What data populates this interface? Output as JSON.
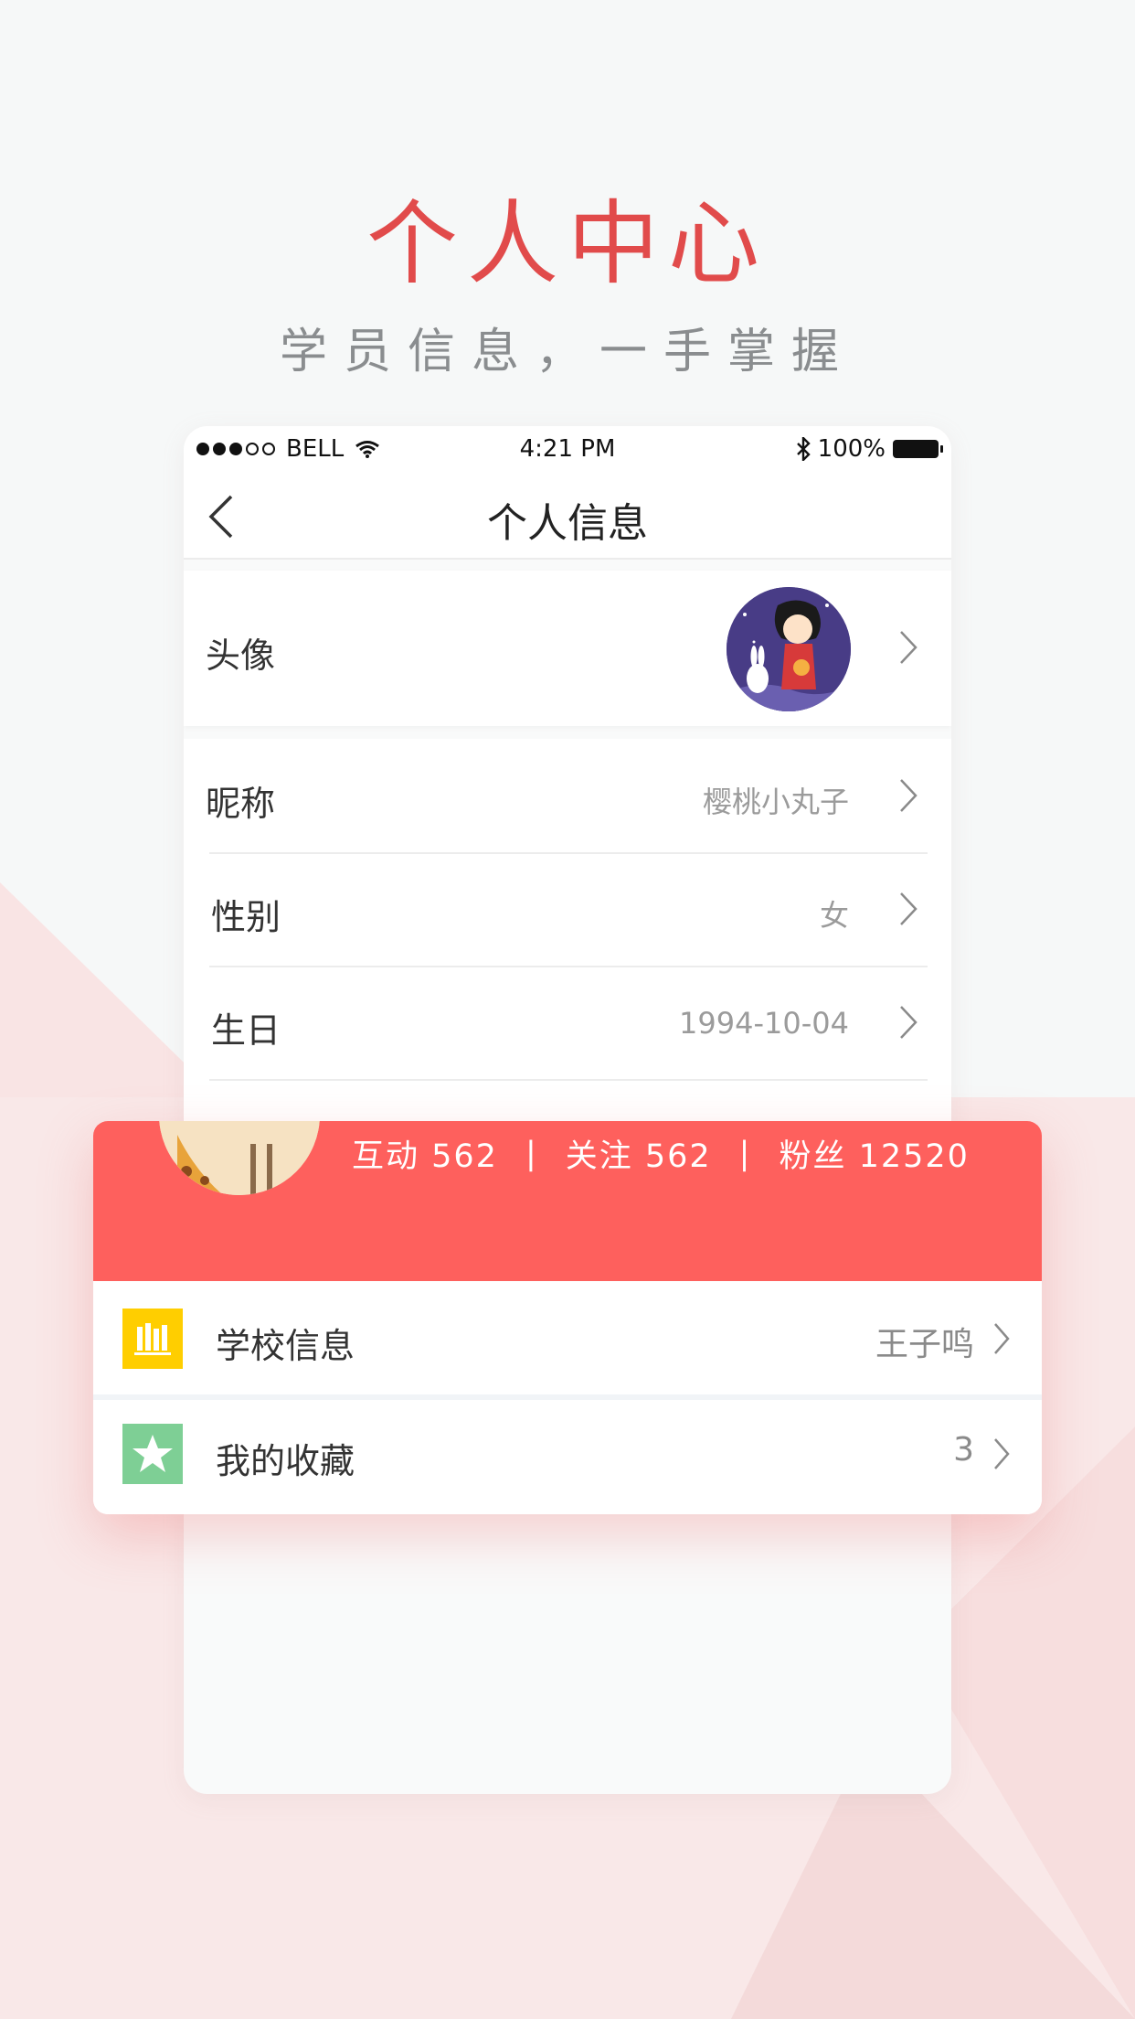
{
  "hero": {
    "title": "个人中心",
    "subtitle": "学员信息，一手掌握"
  },
  "status_bar": {
    "carrier": "BELL",
    "time": "4:21 PM",
    "battery": "100%"
  },
  "nav": {
    "title": "个人信息"
  },
  "profile_rows": [
    {
      "label": "头像",
      "value": ""
    },
    {
      "label": "昵称",
      "value": "樱桃小丸子"
    },
    {
      "label": "性别",
      "value": "女"
    },
    {
      "label": "生日",
      "value": "1994-10-04"
    }
  ],
  "card": {
    "stats": [
      {
        "label": "互动 562"
      },
      {
        "label": "关注 562"
      },
      {
        "label": "粉丝 12520"
      }
    ],
    "separator": "|",
    "items": [
      {
        "label": "学校信息",
        "value": "王子鸣",
        "icon": "books-icon",
        "color": "#ffce00"
      },
      {
        "label": "我的收藏",
        "value": "3",
        "icon": "star-icon",
        "color": "#7ecf95"
      }
    ]
  },
  "colors": {
    "accent_red": "#e14b4b",
    "card_header": "#fe605d"
  }
}
